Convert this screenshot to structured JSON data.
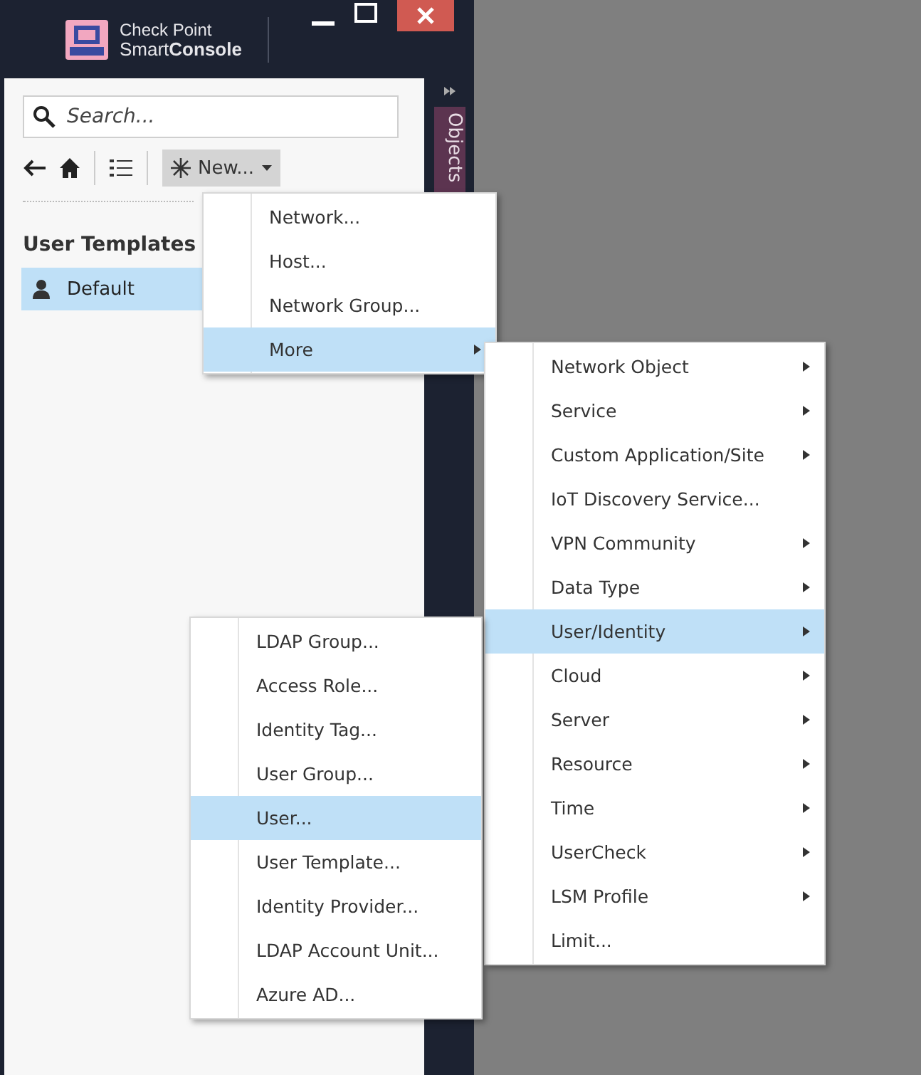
{
  "header": {
    "brand_top": "Check Point",
    "brand_bottom": "Smart**Console**"
  },
  "search": {
    "placeholder": "Search..."
  },
  "toolbar": {
    "new_button": "New..."
  },
  "side_tab": {
    "label": "Objects"
  },
  "section_title": "User Templates",
  "templates": [
    {
      "label": "Default",
      "selected": true
    }
  ],
  "menus": [
    {
      "items": [
        {
          "label": "Network...",
          "submenu": false,
          "selected": false
        },
        {
          "label": "Host...",
          "submenu": false,
          "selected": false
        },
        {
          "label": "Network Group...",
          "submenu": false,
          "selected": false
        },
        {
          "label": "More",
          "submenu": true,
          "selected": true
        }
      ]
    },
    {
      "items": [
        {
          "label": "Network Object",
          "submenu": true,
          "selected": false
        },
        {
          "label": "Service",
          "submenu": true,
          "selected": false
        },
        {
          "label": "Custom Application/Site",
          "submenu": true,
          "selected": false
        },
        {
          "label": "IoT Discovery Service...",
          "submenu": false,
          "selected": false
        },
        {
          "label": "VPN Community",
          "submenu": true,
          "selected": false
        },
        {
          "label": "Data Type",
          "submenu": true,
          "selected": false
        },
        {
          "label": "User/Identity",
          "submenu": true,
          "selected": true
        },
        {
          "label": "Cloud",
          "submenu": true,
          "selected": false
        },
        {
          "label": "Server",
          "submenu": true,
          "selected": false
        },
        {
          "label": "Resource",
          "submenu": true,
          "selected": false
        },
        {
          "label": "Time",
          "submenu": true,
          "selected": false
        },
        {
          "label": "UserCheck",
          "submenu": true,
          "selected": false
        },
        {
          "label": "LSM Profile",
          "submenu": true,
          "selected": false
        },
        {
          "label": "Limit...",
          "submenu": false,
          "selected": false
        }
      ]
    },
    {
      "items": [
        {
          "label": "LDAP Group...",
          "submenu": false,
          "selected": false
        },
        {
          "label": "Access Role...",
          "submenu": false,
          "selected": false
        },
        {
          "label": "Identity Tag...",
          "submenu": false,
          "selected": false
        },
        {
          "label": "User Group...",
          "submenu": false,
          "selected": false
        },
        {
          "label": "User...",
          "submenu": false,
          "selected": true
        },
        {
          "label": "User Template...",
          "submenu": false,
          "selected": false
        },
        {
          "label": "Identity Provider...",
          "submenu": false,
          "selected": false
        },
        {
          "label": "LDAP Account Unit...",
          "submenu": false,
          "selected": false
        },
        {
          "label": "Azure AD...",
          "submenu": false,
          "selected": false
        }
      ]
    }
  ]
}
